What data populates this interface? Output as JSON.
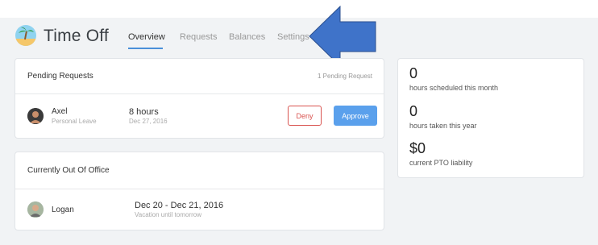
{
  "header": {
    "title": "Time Off",
    "tabs": [
      {
        "label": "Overview",
        "active": true
      },
      {
        "label": "Requests",
        "active": false
      },
      {
        "label": "Balances",
        "active": false
      },
      {
        "label": "Settings",
        "active": false
      }
    ],
    "brand_icon": "palm-tree-icon",
    "annotation": "left-pointing blue arrow toward Settings tab"
  },
  "pending": {
    "title": "Pending Requests",
    "count": "1 Pending Request",
    "request": {
      "name": "Axel",
      "type": "Personal Leave",
      "duration": "8 hours",
      "date": "Dec 27, 2016",
      "deny_label": "Deny",
      "approve_label": "Approve"
    }
  },
  "out_of_office": {
    "title": "Currently Out Of Office",
    "person": {
      "name": "Logan",
      "dates": "Dec 20 - Dec 21, 2016",
      "note": "Vacation until tomorrow"
    }
  },
  "stats": [
    {
      "value": "0",
      "label": "hours scheduled this month"
    },
    {
      "value": "0",
      "label": "hours taken this year"
    },
    {
      "value": "$0",
      "label": "current PTO liability"
    }
  ],
  "colors": {
    "accent": "#4a90d9",
    "approve": "#5aa0ec",
    "deny": "#d9534f",
    "arrow": "#3f73c9",
    "background": "#f1f3f5"
  }
}
